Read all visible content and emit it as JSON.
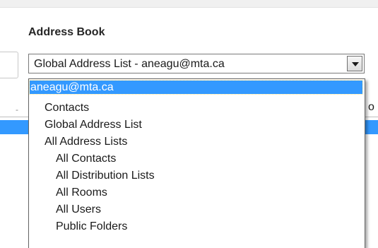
{
  "section_title": "Address Book",
  "combo": {
    "value": "Global Address List - aneagu@mta.ca",
    "arrow_icon": "chevron-down-icon"
  },
  "dropdown": {
    "items": [
      {
        "label": "aneagu@mta.ca",
        "level": 0,
        "selected": true
      },
      {
        "label": "Contacts",
        "level": 1,
        "selected": false
      },
      {
        "label": "Global Address List",
        "level": 1,
        "selected": false
      },
      {
        "label": "All Address Lists",
        "level": 1,
        "selected": false
      },
      {
        "label": "All Contacts",
        "level": 2,
        "selected": false
      },
      {
        "label": "All Distribution Lists",
        "level": 2,
        "selected": false
      },
      {
        "label": "All Rooms",
        "level": 2,
        "selected": false
      },
      {
        "label": "All Users",
        "level": 2,
        "selected": false
      },
      {
        "label": "Public Folders",
        "level": 2,
        "selected": false
      }
    ]
  },
  "background": {
    "right_peek_text": "o",
    "left_tick_text": "-"
  },
  "colors": {
    "selection": "#3399ff",
    "text": "#1a1a1a",
    "border": "#7a7a7a"
  }
}
